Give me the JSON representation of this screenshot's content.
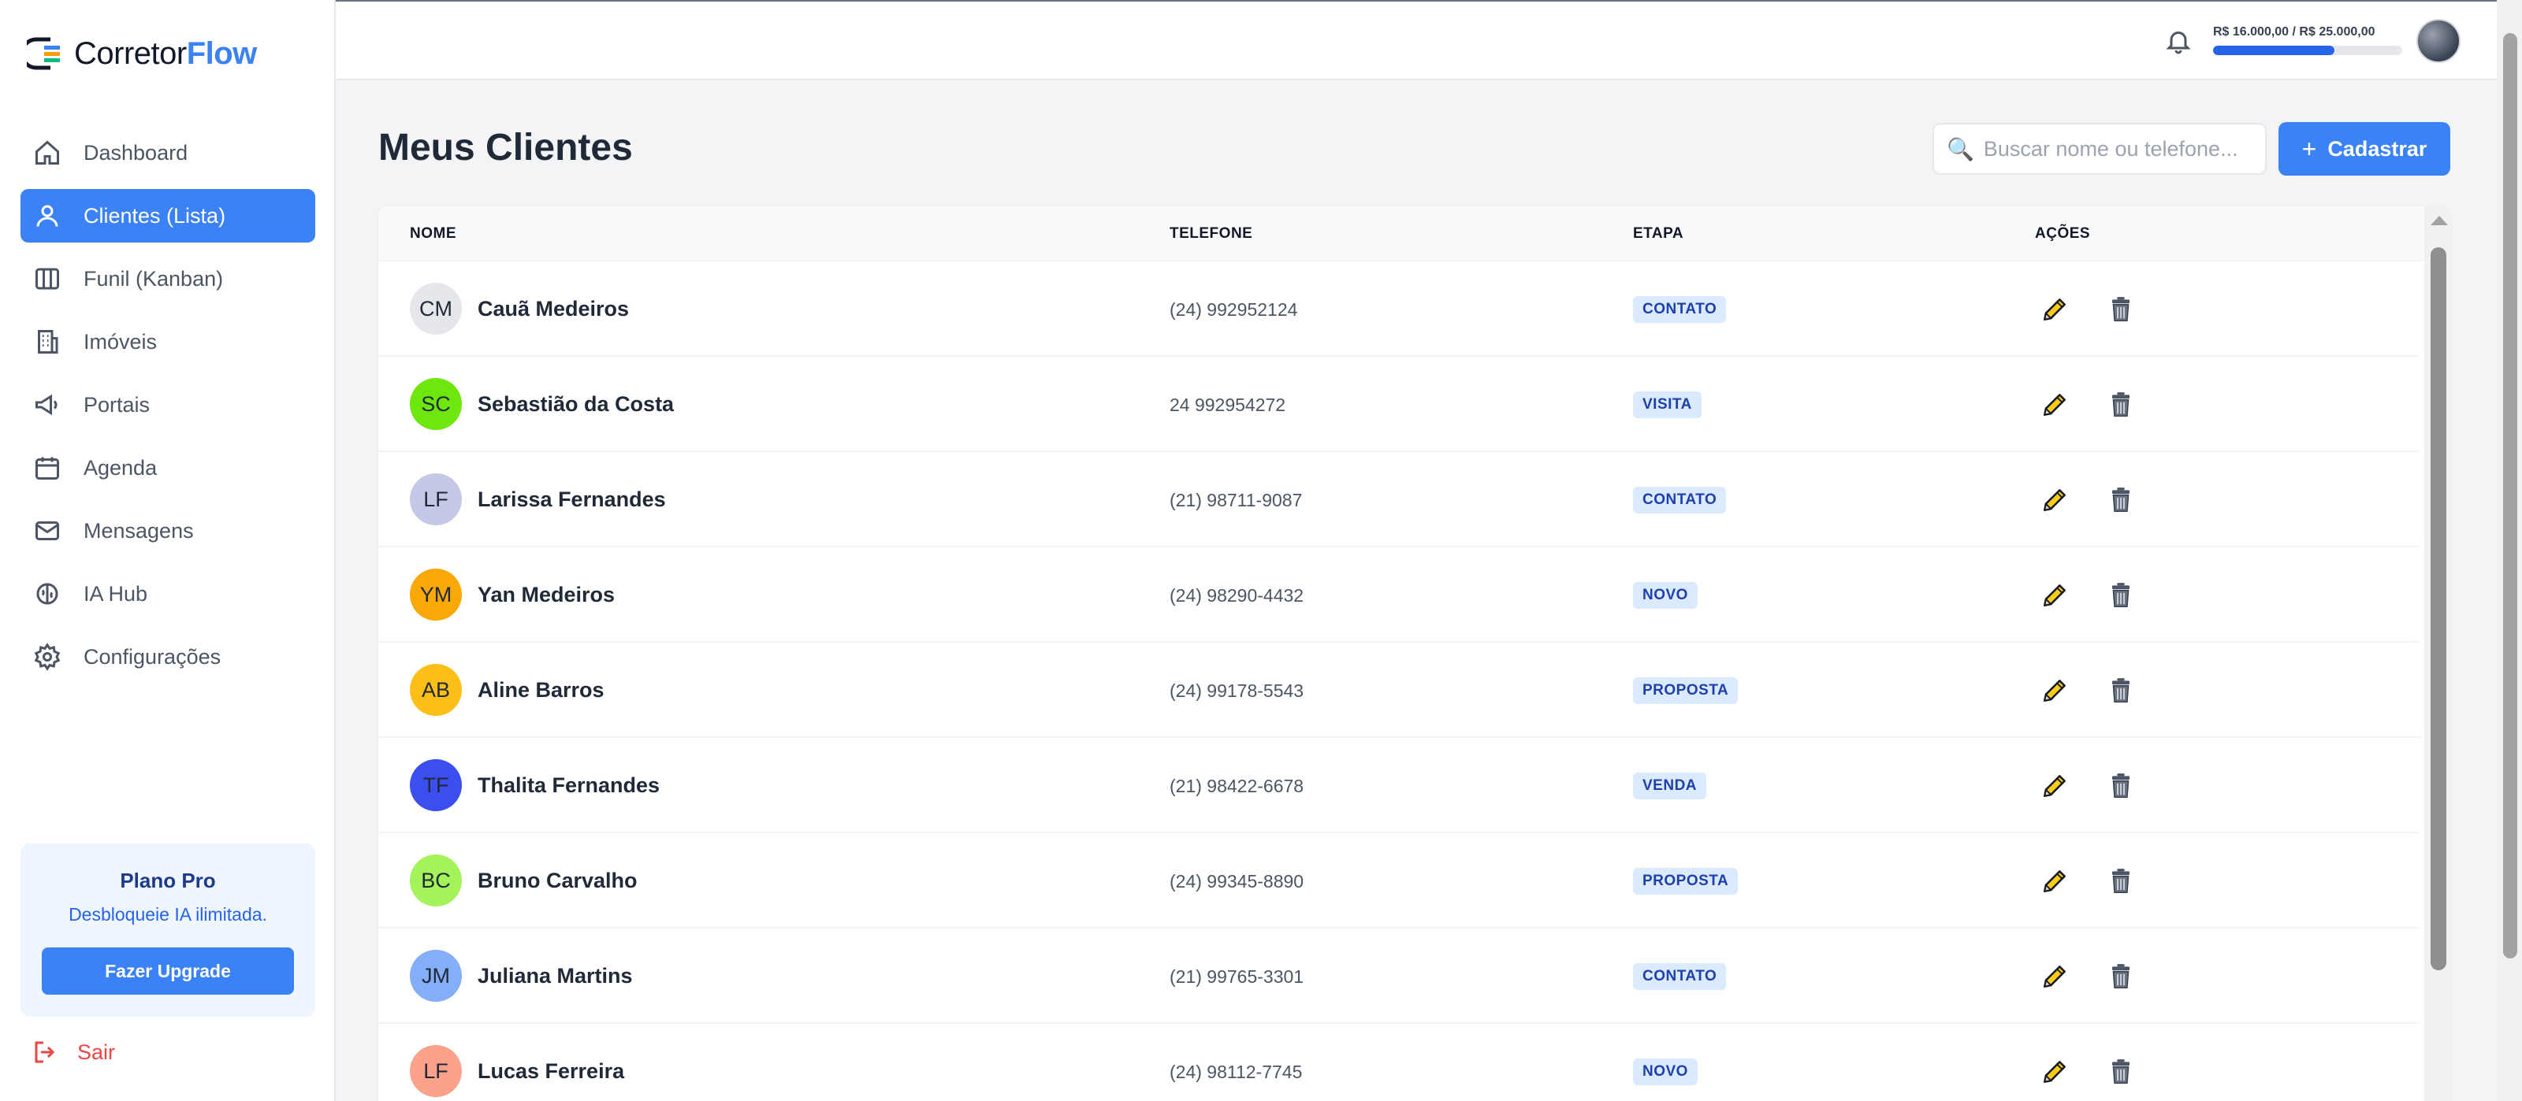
{
  "brand": {
    "part1": "Corretor",
    "part2": "Flow"
  },
  "sidebar": {
    "items": [
      {
        "label": "Dashboard",
        "icon": "home-icon"
      },
      {
        "label": "Clientes (Lista)",
        "icon": "user-icon",
        "active": true
      },
      {
        "label": "Funil (Kanban)",
        "icon": "columns-icon"
      },
      {
        "label": "Imóveis",
        "icon": "building-icon"
      },
      {
        "label": "Portais",
        "icon": "megaphone-icon"
      },
      {
        "label": "Agenda",
        "icon": "calendar-icon"
      },
      {
        "label": "Mensagens",
        "icon": "mail-icon"
      },
      {
        "label": "IA Hub",
        "icon": "brain-icon"
      },
      {
        "label": "Configurações",
        "icon": "gear-icon"
      }
    ],
    "plan": {
      "title": "Plano Pro",
      "subtitle": "Desbloqueie IA ilimitada.",
      "button": "Fazer Upgrade"
    },
    "logout": "Sair"
  },
  "header": {
    "budget_text": "R$ 16.000,00 / R$ 25.000,00",
    "budget_fraction": 0.64
  },
  "main": {
    "title": "Meus Clientes",
    "search_placeholder": "Buscar nome ou telefone...",
    "add_button": "Cadastrar",
    "columns": {
      "name": "NOME",
      "phone": "TELEFONE",
      "stage": "ETAPA",
      "actions": "AÇÕES"
    },
    "clients": [
      {
        "initials": "CM",
        "name": "Cauã Medeiros",
        "phone": "(24) 992952124",
        "stage": "CONTATO",
        "color": "#e5e7eb"
      },
      {
        "initials": "SC",
        "name": "Sebastião da Costa",
        "phone": "24 992954272",
        "stage": "VISITA",
        "color": "#6ee70f"
      },
      {
        "initials": "LF",
        "name": "Larissa Fernandes",
        "phone": "(21) 98711-9087",
        "stage": "CONTATO",
        "color": "#c5c8e6"
      },
      {
        "initials": "YM",
        "name": "Yan Medeiros",
        "phone": "(24) 98290-4432",
        "stage": "NOVO",
        "color": "#f9a805"
      },
      {
        "initials": "AB",
        "name": "Aline Barros",
        "phone": "(24) 99178-5543",
        "stage": "PROPOSTA",
        "color": "#fbbf17"
      },
      {
        "initials": "TF",
        "name": "Thalita Fernandes",
        "phone": "(21) 98422-6678",
        "stage": "VENDA",
        "color": "#3b4ef0"
      },
      {
        "initials": "BC",
        "name": "Bruno Carvalho",
        "phone": "(24) 99345-8890",
        "stage": "PROPOSTA",
        "color": "#a5f35b"
      },
      {
        "initials": "JM",
        "name": "Juliana Martins",
        "phone": "(21) 99765-3301",
        "stage": "CONTATO",
        "color": "#84aef8"
      },
      {
        "initials": "LF",
        "name": "Lucas Ferreira",
        "phone": "(24) 98112-7745",
        "stage": "NOVO",
        "color": "#fca18a"
      }
    ]
  }
}
